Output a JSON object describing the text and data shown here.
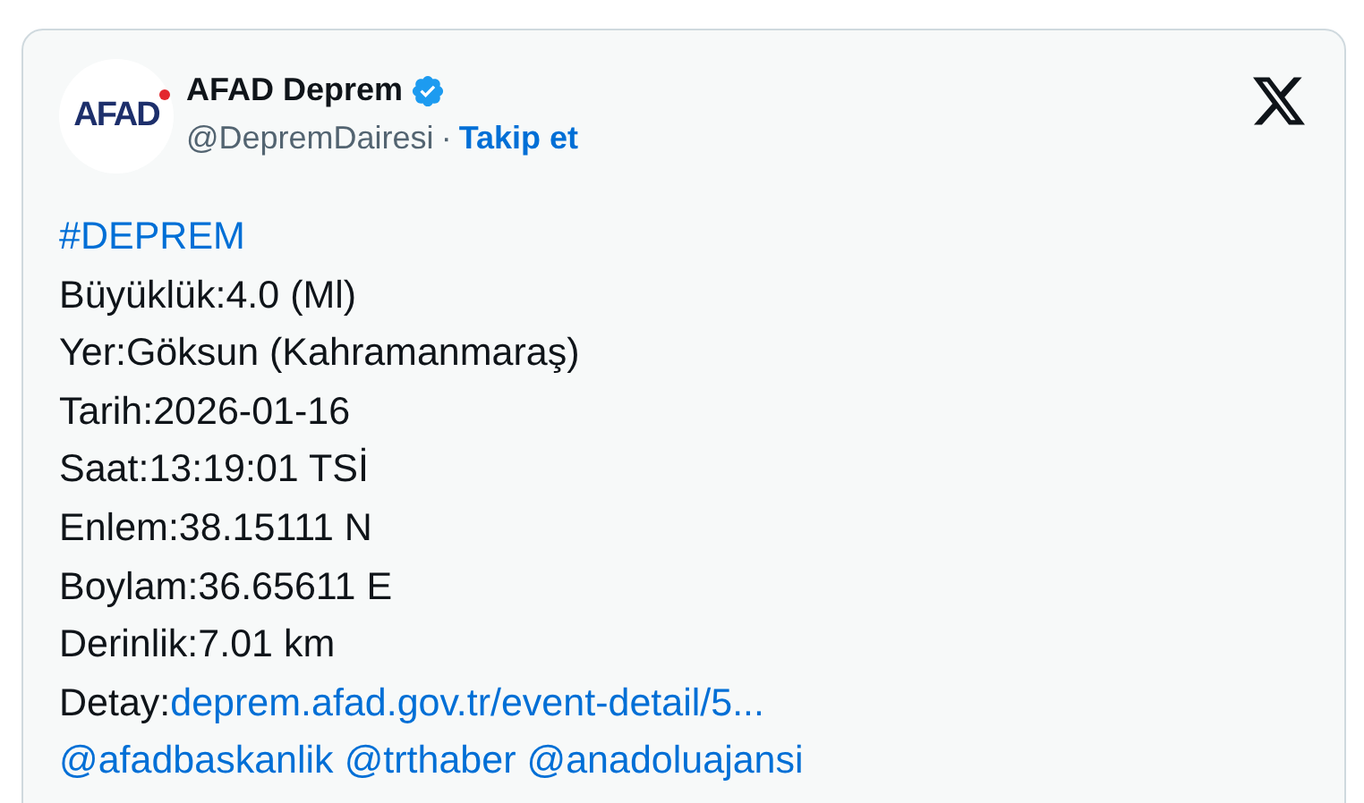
{
  "author": {
    "logo_text": "AFAD",
    "name": "AFAD Deprem",
    "verified": true,
    "handle": "@DepremDairesi",
    "separator": "·",
    "follow": "Takip et"
  },
  "lines": [
    {
      "parts": [
        {
          "kind": "link",
          "text": "#DEPREM"
        }
      ]
    },
    {
      "parts": [
        {
          "kind": "plain",
          "text": "Büyüklük:4.0 (Ml)"
        }
      ]
    },
    {
      "parts": [
        {
          "kind": "plain",
          "text": "Yer:Göksun (Kahramanmaraş)"
        }
      ]
    },
    {
      "parts": [
        {
          "kind": "plain",
          "text": "Tarih:2026-01-16"
        }
      ]
    },
    {
      "parts": [
        {
          "kind": "plain",
          "text": "Saat:13:19:01 TSİ"
        }
      ]
    },
    {
      "parts": [
        {
          "kind": "plain",
          "text": "Enlem:38.15111 N"
        }
      ]
    },
    {
      "parts": [
        {
          "kind": "plain",
          "text": "Boylam:36.65611 E"
        }
      ]
    },
    {
      "parts": [
        {
          "kind": "plain",
          "text": "Derinlik:7.01 km"
        }
      ]
    },
    {
      "parts": [
        {
          "kind": "plain",
          "text": "Detay:"
        },
        {
          "kind": "link",
          "text": "deprem.afad.gov.tr/event-detail/5..."
        }
      ]
    },
    {
      "parts": [
        {
          "kind": "link",
          "text": "@afadbaskanlik"
        },
        {
          "kind": "link",
          "text": "@trthaber"
        },
        {
          "kind": "link",
          "text": "@anadoluajansi"
        }
      ]
    }
  ]
}
